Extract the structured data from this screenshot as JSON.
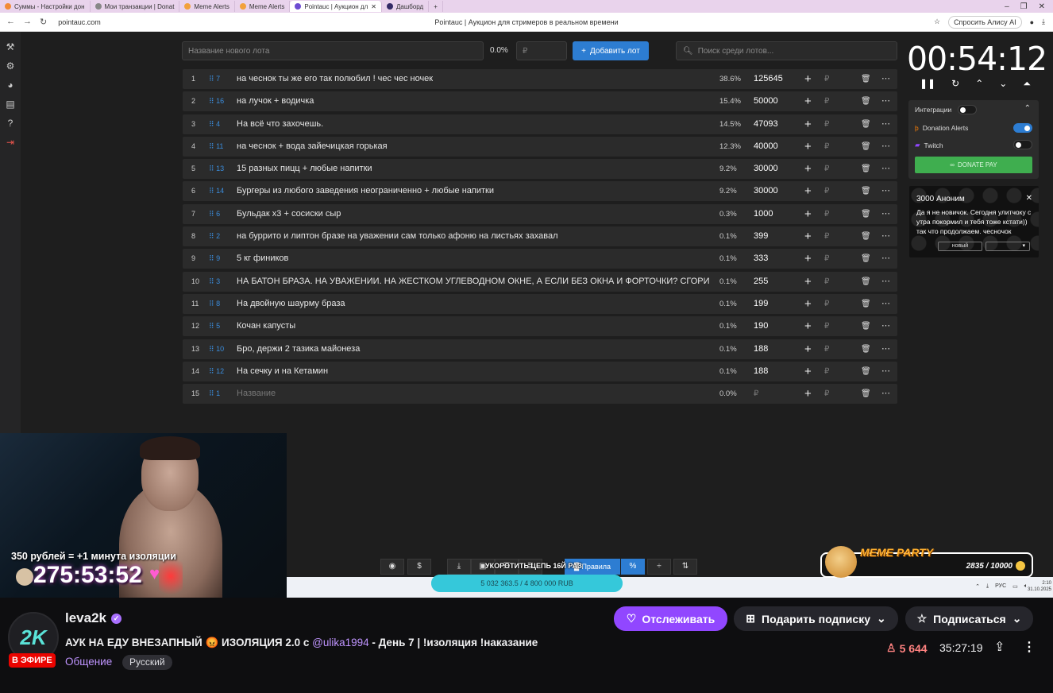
{
  "browser": {
    "tabs": [
      {
        "label": "Суммы - Настройки дон",
        "color": "#f28b36"
      },
      {
        "label": "Мои транзакции | Donat",
        "color": "#888888"
      },
      {
        "label": "Meme Alerts",
        "color": "#f2a13c"
      },
      {
        "label": "Meme Alerts",
        "color": "#f2a13c"
      },
      {
        "label": "Pointauc | Аукцион дл",
        "color": "#6d4cd2"
      },
      {
        "label": "Дашборд",
        "color": "#332a66"
      }
    ],
    "url": "pointauc.com",
    "page_title": "Pointauc | Аукцион для стримеров в реальном времени",
    "alice_label": "Спросить Алису AI"
  },
  "toolbar": {
    "new_lot_placeholder": "Название нового лота",
    "percent": "0.0%",
    "sum_placeholder": "₽",
    "add_button": "Добавить лот",
    "search_placeholder": "Поиск среди лотов..."
  },
  "lots": [
    {
      "num": "1",
      "id": "7",
      "name": "на чеснок ты же его так полюбил ! чес чес ночек",
      "percent": "38.6%",
      "amount": "125645"
    },
    {
      "num": "2",
      "id": "16",
      "name": "на лучок + водичка",
      "percent": "15.4%",
      "amount": "50000"
    },
    {
      "num": "3",
      "id": "4",
      "name": "На всё что захочешь.",
      "percent": "14.5%",
      "amount": "47093"
    },
    {
      "num": "4",
      "id": "11",
      "name": " на чеснок + вода зайечицкая горькая",
      "percent": "12.3%",
      "amount": "40000"
    },
    {
      "num": "5",
      "id": "13",
      "name": "15 разных пицц + любые напитки",
      "percent": "9.2%",
      "amount": "30000"
    },
    {
      "num": "6",
      "id": "14",
      "name": "Бургеры из любого заведения неограниченно + любые напитки",
      "percent": "9.2%",
      "amount": "30000"
    },
    {
      "num": "7",
      "id": "6",
      "name": "Бульдак x3 + сосиски сыр",
      "percent": "0.3%",
      "amount": "1000"
    },
    {
      "num": "8",
      "id": "2",
      "name": "на буррито и липтон бразе на уважении сам только афоню на листьях захавал",
      "percent": "0.1%",
      "amount": "399"
    },
    {
      "num": "9",
      "id": "9",
      "name": "5 кг фиников",
      "percent": "0.1%",
      "amount": "333"
    },
    {
      "num": "10",
      "id": "3",
      "name": "НА БАТОН БРАЗА. НА УВАЖЕНИИ. НА ЖЕСТКОМ УГЛЕВОДНОМ ОКНЕ, А ЕСЛИ БЕЗ ОКНА И ФОРТОЧКИ? СГОРИШЬ",
      "percent": "0.1%",
      "amount": "255"
    },
    {
      "num": "11",
      "id": "8",
      "name": "На двойную шаурму браза",
      "percent": "0.1%",
      "amount": "199"
    },
    {
      "num": "12",
      "id": "5",
      "name": "Кочан капусты",
      "percent": "0.1%",
      "amount": "190"
    },
    {
      "num": "13",
      "id": "10",
      "name": "Бро, держи 2 тазика майонеза",
      "percent": "0.1%",
      "amount": "188"
    },
    {
      "num": "14",
      "id": "12",
      "name": "На сечку и на Кетамин",
      "percent": "0.1%",
      "amount": "188"
    },
    {
      "num": "15",
      "id": "1",
      "name": "Название",
      "percent": "0.0%",
      "amount": "₽",
      "placeholder": true
    }
  ],
  "timer": "00:54:12",
  "integrations": {
    "label": "Интеграции",
    "donation_alerts": "Donation Alerts",
    "twitch": "Twitch",
    "donate_pay": "DONATE PAY"
  },
  "alert_card": {
    "title": "3000 Аноним",
    "message": "Да я не новичок. Сегодня улитчоку с утра покормил и тебя тоже кстати)) так что продолжаем. чесночок",
    "status": "новый"
  },
  "bottom_bar": {
    "rules": "Правила",
    "shorten": "УКОРОТИТЬ ЦЕПЬ 16Й РАЗ"
  },
  "goal": {
    "text": "5 032 363.5 / 4 800 000 RUB",
    "progress": 1.0
  },
  "taskbar": {
    "lang": "РУС",
    "time": "2:10",
    "date": "31.10.2025"
  },
  "overlay": {
    "rate": "350 рублей = +1 минута изоляции",
    "counter": "275:53:52",
    "meme_title": "MEME PARTY",
    "meme_count": "2835 / 10000"
  },
  "stream": {
    "channel": "leva2k",
    "avatar_text": "2K",
    "live": "В ЭФИРЕ",
    "title_part1": "АУК НА ЕДУ ВНЕЗАПНЫЙ 😡 ИЗОЛЯЦИЯ 2.0 с ",
    "mention": "@ulika1994",
    "title_part2": " - День 7 | !изоляция !наказание",
    "category": "Общение",
    "language": "Русский",
    "follow": "Отслеживать",
    "gift": "Подарить подписку",
    "subscribe": "Подписаться",
    "viewers": "5 644",
    "uptime": "35:27:19"
  },
  "colors": {
    "accent": "#9147ff",
    "auction_blue": "#2d7dd2",
    "live_red": "#eb0400"
  }
}
